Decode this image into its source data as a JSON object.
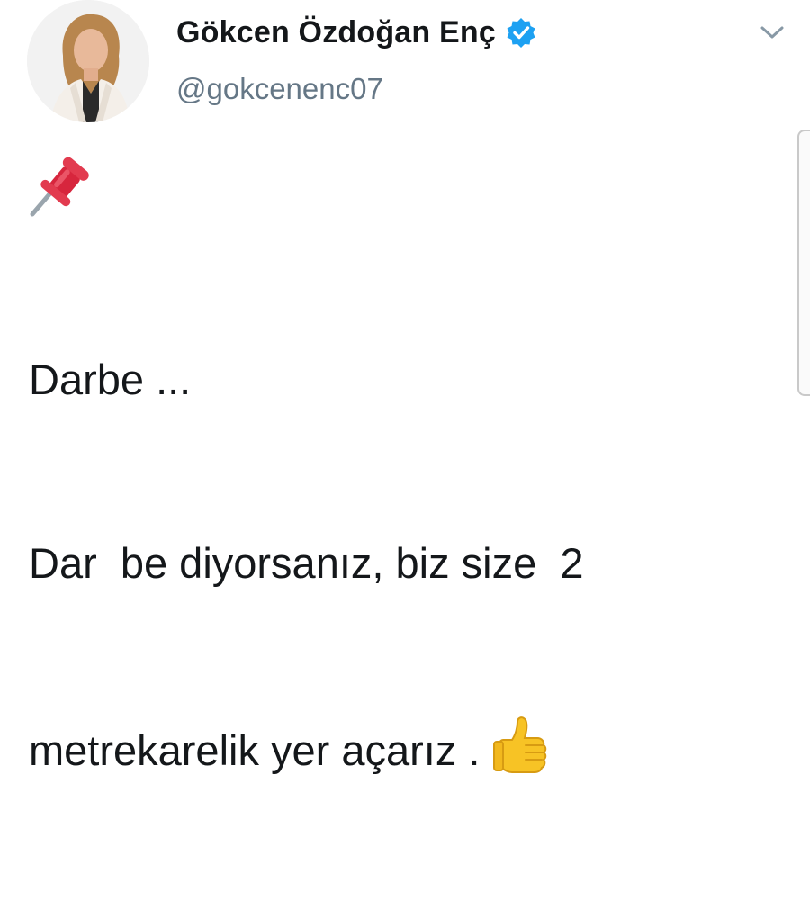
{
  "tweet": {
    "display_name": "Gökcen Özdoğan Enç",
    "handle": "@gokcenenc07",
    "verified": true,
    "text_lines": [
      "Darbe ...",
      "Dar  be diyorsanız, biz size  2",
      "metrekarelik yer açarız ."
    ],
    "icons": {
      "pin": "pushpin-icon",
      "thumbs_up": "thumbs-up-icon",
      "verified": "verified-badge-icon",
      "caret": "chevron-down-icon"
    }
  },
  "colors": {
    "text": "#14171a",
    "handle": "#657786",
    "verified_blue": "#1da1f2",
    "pin_red": "#d7263d",
    "thumbs_yellow": "#f7c325"
  }
}
